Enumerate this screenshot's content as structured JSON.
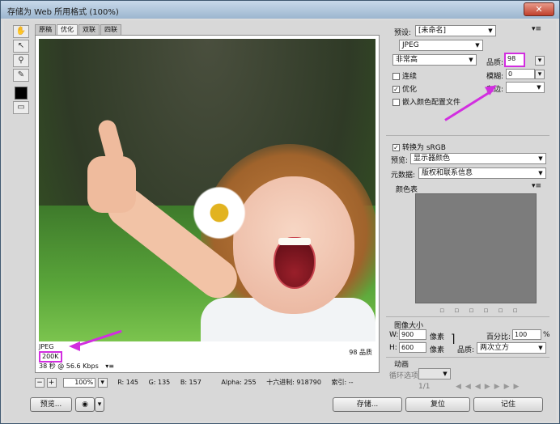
{
  "window": {
    "title": "存储为 Web 所用格式 (100%)",
    "close_glyph": "✕"
  },
  "tools": [
    "hand-icon",
    "slice-select-icon",
    "zoom-icon",
    "eyedropper-icon"
  ],
  "tabs": [
    "原稿",
    "优化",
    "双联",
    "四联"
  ],
  "preview": {
    "format": "JPEG",
    "size": "200K",
    "timing": "38 秒 @ 56.6 Kbps",
    "timing_menu": "▾≡",
    "quality_label": "98 品质"
  },
  "status": {
    "zoom_minus": "−",
    "zoom_plus": "+",
    "zoom": "100%",
    "r": "R: 145",
    "g": "G: 135",
    "b": "B: 157",
    "alpha": "Alpha: 255",
    "hex": "十六进制: 918790",
    "index": "索引: --"
  },
  "settings": {
    "preset_label": "预设:",
    "preset_value": "[未命名]",
    "format_value": "JPEG",
    "quality_level": "非常高",
    "quality_label": "品质:",
    "quality_value": "98",
    "progressive_label": "连续",
    "blur_label": "模糊:",
    "blur_value": "0",
    "optimized_label": "优化",
    "matte_label": "杂边:",
    "embed_profile_label": "嵌入颜色配置文件",
    "convert_srgb_label": "转换为 sRGB",
    "preview_label": "预览:",
    "preview_value": "显示器颜色",
    "metadata_label": "元数据:",
    "metadata_value": "版权和联系信息",
    "color_table_label": "颜色表"
  },
  "image_size": {
    "title": "图像大小",
    "w_label": "W:",
    "w_value": "900",
    "h_label": "H:",
    "h_value": "600",
    "unit": "像素",
    "percent_label": "百分比:",
    "percent_value": "100",
    "percent_unit": "%",
    "quality_label": "品质:",
    "quality_value": "两次立方"
  },
  "animation": {
    "title": "动画",
    "loop_label": "循环选项:",
    "frame_counter": "1/1"
  },
  "buttons": {
    "preview": "预览...",
    "save": "存储...",
    "reset": "复位",
    "remember": "记住",
    "browser_icon": "browser-icon"
  },
  "colors": {
    "highlight": "#d22ee0",
    "color_table": "#7c7c7c"
  }
}
